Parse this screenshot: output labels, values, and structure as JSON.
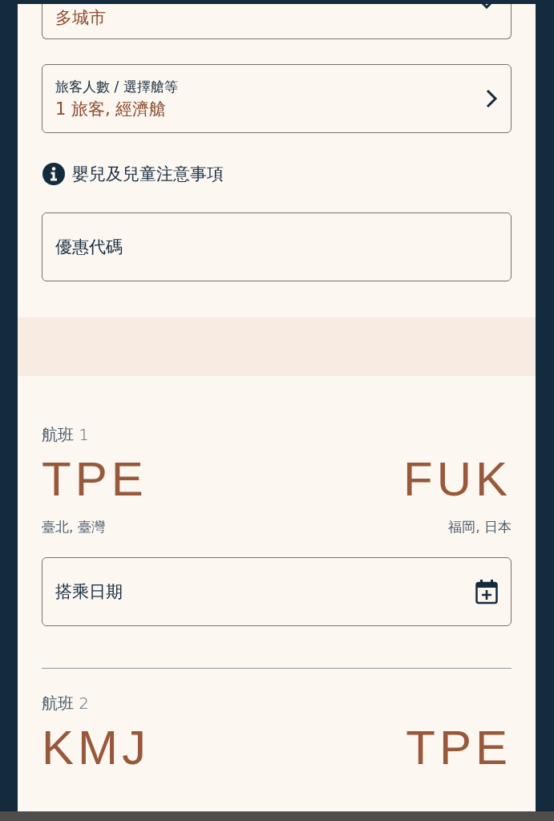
{
  "trip_type": {
    "value": "多城市"
  },
  "passengers": {
    "label": "旅客人數 / 選擇艙等",
    "value": "1 旅客, 經濟艙"
  },
  "notice_link": "嬰兒及兒童注意事項",
  "promo_code": {
    "placeholder": "優惠代碼"
  },
  "flights": [
    {
      "label": "航班 1",
      "origin": {
        "code": "TPE",
        "city": "臺北, 臺灣"
      },
      "destination": {
        "code": "FUK",
        "city": "福岡, 日本"
      },
      "date_field": {
        "placeholder": "搭乘日期"
      }
    },
    {
      "label": "航班 2",
      "origin": {
        "code": "KMJ"
      },
      "destination": {
        "code": "TPE"
      }
    }
  ]
}
